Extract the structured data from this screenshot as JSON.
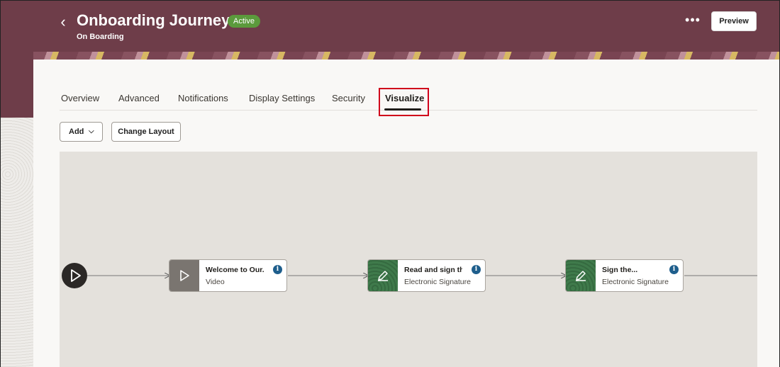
{
  "header": {
    "back_icon": "chevron-left-icon",
    "title": "Onboarding Journey",
    "status": "Active",
    "subtitle": "On Boarding",
    "more_icon": "more-horizontal-icon",
    "more_glyph": "•••",
    "preview_label": "Preview"
  },
  "tabs": [
    {
      "label": "Overview",
      "active": false
    },
    {
      "label": "Advanced",
      "active": false
    },
    {
      "label": "Notifications",
      "active": false
    },
    {
      "label": "Display Settings",
      "active": false
    },
    {
      "label": "Security",
      "active": false
    },
    {
      "label": "Visualize",
      "active": true
    }
  ],
  "toolbar": {
    "add_label": "Add",
    "change_layout_label": "Change Layout"
  },
  "flow": {
    "start_icon": "play-circle-icon",
    "nodes": [
      {
        "title": "Welcome to Our...",
        "type": "Video",
        "icon": "play-icon"
      },
      {
        "title": "Read and sign the...",
        "type": "Electronic Signature",
        "icon": "pen-icon"
      },
      {
        "title": "Sign the...",
        "type": "Electronic Signature",
        "icon": "pen-icon"
      }
    ]
  },
  "colors": {
    "header_bg": "#6e3d49",
    "active_badge": "#5b9a3c",
    "info_icon": "#1e5e8c",
    "highlight": "#d0021b"
  }
}
